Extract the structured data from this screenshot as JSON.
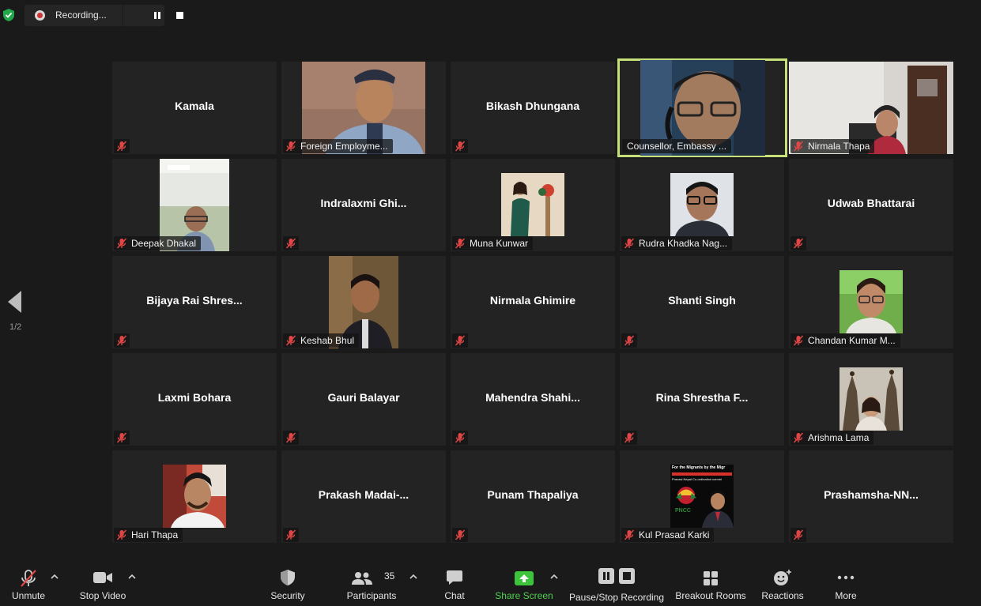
{
  "recording": {
    "label": "Recording..."
  },
  "pager": {
    "indicator": "1/2"
  },
  "tiles": [
    {
      "name": "Kamala"
    },
    {
      "name": "Foreign Employme..."
    },
    {
      "name": "Bikash Dhungana"
    },
    {
      "name": "Counsellor, Embassy ..."
    },
    {
      "name": "Nirmala Thapa"
    },
    {
      "name": "Deepak Dhakal"
    },
    {
      "name": "Indralaxmi  Ghi..."
    },
    {
      "name": "Muna Kunwar"
    },
    {
      "name": "Rudra Khadka Nag..."
    },
    {
      "name": "Udwab Bhattarai"
    },
    {
      "name": "Bijaya  Rai  Shres..."
    },
    {
      "name": "Keshab Bhul"
    },
    {
      "name": "Nirmala Ghimire"
    },
    {
      "name": "Shanti Singh"
    },
    {
      "name": "Chandan Kumar M..."
    },
    {
      "name": "Laxmi Bohara"
    },
    {
      "name": "Gauri Balayar"
    },
    {
      "name": "Mahendra  Shahi..."
    },
    {
      "name": "Rina Shrestha  F..."
    },
    {
      "name": "Arishma Lama"
    },
    {
      "name": "Hari Thapa"
    },
    {
      "name": "Prakash  Madai-..."
    },
    {
      "name": "Punam Thapaliya"
    },
    {
      "name": "Kul Prasad Karki"
    },
    {
      "name": "Prashamsha-NN..."
    }
  ],
  "poster": {
    "line1": "For the Migrants by the Migr",
    "line2": "Pravasi Nepal Co-ordination commi",
    "acronym": "PNCC"
  },
  "toolbar": {
    "unmute": "Unmute",
    "stop_video": "Stop Video",
    "security": "Security",
    "participants": "Participants",
    "participant_count": "35",
    "chat": "Chat",
    "share_screen": "Share Screen",
    "pause_stop_recording": "Pause/Stop Recording",
    "breakout_rooms": "Breakout Rooms",
    "reactions": "Reactions",
    "more": "More"
  },
  "colors": {
    "active_speaker_border": "#c8e07a",
    "share_green": "#52d052",
    "mute_red": "#e04646"
  }
}
